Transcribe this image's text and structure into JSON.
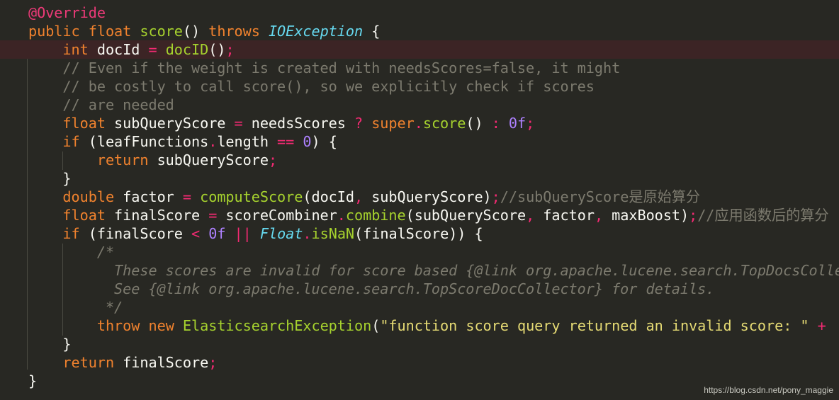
{
  "editor": {
    "theme_colors": {
      "background": "#282823",
      "current_line": "#3c2425",
      "keyword": "#f0822e",
      "function": "#a6d22e",
      "operator": "#f22a72",
      "number": "#ae81ff",
      "type": "#66d9ef",
      "comment": "#7c7a6e",
      "string": "#e6db74",
      "identifier": "#f8f8f2"
    },
    "highlighted_line": 3,
    "lines": [
      [
        {
          "t": "an",
          "v": "@Override"
        }
      ],
      [
        {
          "t": "kw",
          "v": "public"
        },
        {
          "t": "id",
          "v": " "
        },
        {
          "t": "kw",
          "v": "float"
        },
        {
          "t": "id",
          "v": " "
        },
        {
          "t": "fn",
          "v": "score"
        },
        {
          "t": "id",
          "v": "() "
        },
        {
          "t": "kw",
          "v": "throws"
        },
        {
          "t": "id",
          "v": " "
        },
        {
          "t": "ty",
          "v": "IOException"
        },
        {
          "t": "id",
          "v": " {"
        }
      ],
      [
        {
          "t": "id",
          "v": "    "
        },
        {
          "t": "kw",
          "v": "int"
        },
        {
          "t": "id",
          "v": " docId "
        },
        {
          "t": "op",
          "v": "="
        },
        {
          "t": "id",
          "v": " "
        },
        {
          "t": "fn",
          "v": "docID"
        },
        {
          "t": "id",
          "v": "()"
        },
        {
          "t": "op",
          "v": ";"
        }
      ],
      [
        {
          "t": "id",
          "v": "    "
        },
        {
          "t": "cm",
          "v": "// Even if the weight is created with needsScores=false, it might"
        }
      ],
      [
        {
          "t": "id",
          "v": "    "
        },
        {
          "t": "cm",
          "v": "// be costly to call score(), so we explicitly check if scores"
        }
      ],
      [
        {
          "t": "id",
          "v": "    "
        },
        {
          "t": "cm",
          "v": "// are needed"
        }
      ],
      [
        {
          "t": "id",
          "v": "    "
        },
        {
          "t": "kw",
          "v": "float"
        },
        {
          "t": "id",
          "v": " subQueryScore "
        },
        {
          "t": "op",
          "v": "="
        },
        {
          "t": "id",
          "v": " needsScores "
        },
        {
          "t": "op",
          "v": "?"
        },
        {
          "t": "id",
          "v": " "
        },
        {
          "t": "kw",
          "v": "super"
        },
        {
          "t": "op",
          "v": "."
        },
        {
          "t": "fn",
          "v": "score"
        },
        {
          "t": "id",
          "v": "() "
        },
        {
          "t": "op",
          "v": ":"
        },
        {
          "t": "id",
          "v": " "
        },
        {
          "t": "num",
          "v": "0f"
        },
        {
          "t": "op",
          "v": ";"
        }
      ],
      [
        {
          "t": "id",
          "v": "    "
        },
        {
          "t": "kw",
          "v": "if"
        },
        {
          "t": "id",
          "v": " (leafFunctions"
        },
        {
          "t": "op",
          "v": "."
        },
        {
          "t": "id",
          "v": "length "
        },
        {
          "t": "op",
          "v": "=="
        },
        {
          "t": "id",
          "v": " "
        },
        {
          "t": "num",
          "v": "0"
        },
        {
          "t": "id",
          "v": ") {"
        }
      ],
      [
        {
          "t": "id",
          "v": "        "
        },
        {
          "t": "kw",
          "v": "return"
        },
        {
          "t": "id",
          "v": " subQueryScore"
        },
        {
          "t": "op",
          "v": ";"
        }
      ],
      [
        {
          "t": "id",
          "v": "    }"
        }
      ],
      [
        {
          "t": "id",
          "v": "    "
        },
        {
          "t": "kw",
          "v": "double"
        },
        {
          "t": "id",
          "v": " factor "
        },
        {
          "t": "op",
          "v": "="
        },
        {
          "t": "id",
          "v": " "
        },
        {
          "t": "fn",
          "v": "computeScore"
        },
        {
          "t": "id",
          "v": "(docId"
        },
        {
          "t": "op",
          "v": ","
        },
        {
          "t": "id",
          "v": " subQueryScore)"
        },
        {
          "t": "op",
          "v": ";"
        },
        {
          "t": "cm",
          "v": "//subQueryScore是原始算分"
        }
      ],
      [
        {
          "t": "id",
          "v": "    "
        },
        {
          "t": "kw",
          "v": "float"
        },
        {
          "t": "id",
          "v": " finalScore "
        },
        {
          "t": "op",
          "v": "="
        },
        {
          "t": "id",
          "v": " scoreCombiner"
        },
        {
          "t": "op",
          "v": "."
        },
        {
          "t": "fn",
          "v": "combine"
        },
        {
          "t": "id",
          "v": "(subQueryScore"
        },
        {
          "t": "op",
          "v": ","
        },
        {
          "t": "id",
          "v": " factor"
        },
        {
          "t": "op",
          "v": ","
        },
        {
          "t": "id",
          "v": " maxBoost)"
        },
        {
          "t": "op",
          "v": ";"
        },
        {
          "t": "cm",
          "v": "//应用函数后的算分"
        }
      ],
      [
        {
          "t": "id",
          "v": "    "
        },
        {
          "t": "kw",
          "v": "if"
        },
        {
          "t": "id",
          "v": " (finalScore "
        },
        {
          "t": "op",
          "v": "<"
        },
        {
          "t": "id",
          "v": " "
        },
        {
          "t": "num",
          "v": "0f"
        },
        {
          "t": "id",
          "v": " "
        },
        {
          "t": "op",
          "v": "||"
        },
        {
          "t": "id",
          "v": " "
        },
        {
          "t": "ty",
          "v": "Float"
        },
        {
          "t": "op",
          "v": "."
        },
        {
          "t": "fn",
          "v": "isNaN"
        },
        {
          "t": "id",
          "v": "(finalScore)) {"
        }
      ],
      [
        {
          "t": "id",
          "v": "        "
        },
        {
          "t": "cmi",
          "v": "/*"
        }
      ],
      [
        {
          "t": "id",
          "v": "          "
        },
        {
          "t": "cmi",
          "v": "These scores are invalid for score based {@link org.apache.lucene.search.TopDocsCollector}"
        }
      ],
      [
        {
          "t": "id",
          "v": "          "
        },
        {
          "t": "cmi",
          "v": "See {@link org.apache.lucene.search.TopScoreDocCollector} for details."
        }
      ],
      [
        {
          "t": "id",
          "v": "         "
        },
        {
          "t": "cmi",
          "v": "*/"
        }
      ],
      [
        {
          "t": "id",
          "v": "        "
        },
        {
          "t": "kw",
          "v": "throw"
        },
        {
          "t": "id",
          "v": " "
        },
        {
          "t": "kw",
          "v": "new"
        },
        {
          "t": "id",
          "v": " "
        },
        {
          "t": "fn",
          "v": "ElasticsearchException"
        },
        {
          "t": "id",
          "v": "("
        },
        {
          "t": "str",
          "v": "\"function score query returned an invalid score: \""
        },
        {
          "t": "id",
          "v": " "
        },
        {
          "t": "op",
          "v": "+"
        }
      ],
      [
        {
          "t": "id",
          "v": "    }"
        }
      ],
      [
        {
          "t": "id",
          "v": "    "
        },
        {
          "t": "kw",
          "v": "return"
        },
        {
          "t": "id",
          "v": " finalScore"
        },
        {
          "t": "op",
          "v": ";"
        }
      ],
      [
        {
          "t": "id",
          "v": "}"
        }
      ]
    ]
  },
  "watermark": "https://blog.csdn.net/pony_maggie"
}
